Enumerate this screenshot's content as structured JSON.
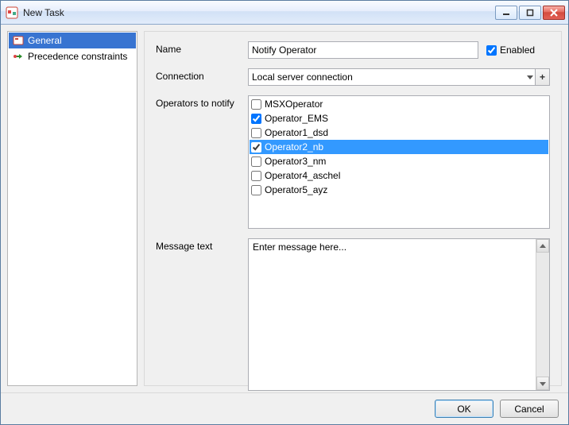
{
  "window": {
    "title": "New Task"
  },
  "sidebar": {
    "items": [
      {
        "label": "General",
        "selected": true
      },
      {
        "label": "Precedence constraints",
        "selected": false
      }
    ]
  },
  "form": {
    "name_label": "Name",
    "name_value": "Notify Operator",
    "enabled_label": "Enabled",
    "enabled_checked": true,
    "connection_label": "Connection",
    "connection_value": "Local server connection",
    "operators_label": "Operators to notify",
    "operators": [
      {
        "label": "MSXOperator",
        "checked": false,
        "selected": false
      },
      {
        "label": "Operator_EMS",
        "checked": true,
        "selected": false
      },
      {
        "label": "Operator1_dsd",
        "checked": false,
        "selected": false
      },
      {
        "label": "Operator2_nb",
        "checked": true,
        "selected": true
      },
      {
        "label": "Operator3_nm",
        "checked": false,
        "selected": false
      },
      {
        "label": "Operator4_aschel",
        "checked": false,
        "selected": false
      },
      {
        "label": "Operator5_ayz",
        "checked": false,
        "selected": false
      }
    ],
    "message_label": "Message text",
    "message_value": "Enter message here..."
  },
  "footer": {
    "ok_label": "OK",
    "cancel_label": "Cancel"
  }
}
